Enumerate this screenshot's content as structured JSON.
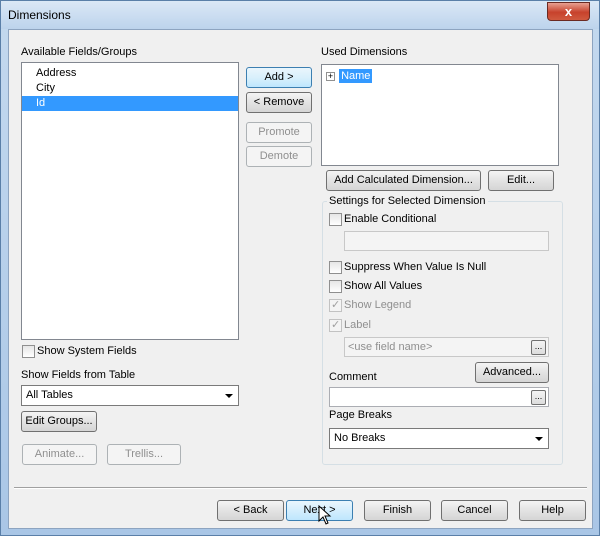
{
  "window": {
    "title": "Dimensions",
    "close_label": "x"
  },
  "available": {
    "label": "Available Fields/Groups",
    "items": [
      "Address",
      "City",
      "Id"
    ],
    "selected_index": 2
  },
  "used": {
    "label": "Used Dimensions",
    "items": [
      {
        "expander": "+",
        "label": "Name"
      }
    ]
  },
  "buttons": {
    "add": "Add >",
    "remove": "< Remove",
    "promote": "Promote",
    "demote": "Demote",
    "add_calc": "Add Calculated Dimension...",
    "edit": "Edit...",
    "edit_groups": "Edit Groups...",
    "animate": "Animate...",
    "trellis": "Trellis...",
    "advanced": "Advanced...",
    "ellipsis": "..."
  },
  "show_system_fields": {
    "label": "Show System Fields",
    "checked": false
  },
  "show_fields_from": {
    "label": "Show Fields from Table",
    "value": "All Tables"
  },
  "settings": {
    "group_label": "Settings for Selected Dimension",
    "enable_conditional": "Enable Conditional",
    "suppress_null": "Suppress When Value Is Null",
    "show_all_values": "Show All Values",
    "show_legend": "Show Legend",
    "label": "Label",
    "label_placeholder": "<use field name>",
    "comment": "Comment",
    "page_breaks": "Page Breaks",
    "page_breaks_value": "No Breaks"
  },
  "footer": {
    "back": "< Back",
    "next": "Next >",
    "finish": "Finish",
    "cancel": "Cancel",
    "help": "Help"
  }
}
